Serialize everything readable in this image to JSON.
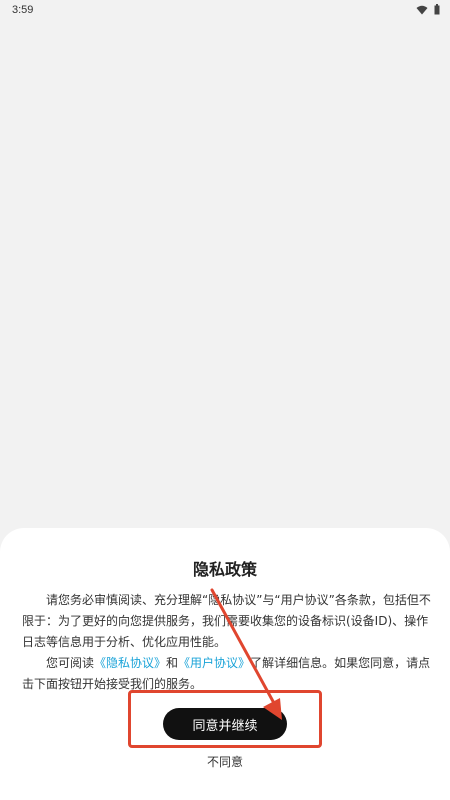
{
  "status_bar": {
    "time": "3:59",
    "icons": [
      "wifi-icon",
      "battery-icon"
    ]
  },
  "dialog": {
    "title": "隐私政策",
    "paragraph1": {
      "text": "请您务必审慎阅读、充分理解“隐私协议”与“用户协议”各条款，包括但不限于：为了更好的向您提供服务，我们需要收集您的设备标识(设备ID)、操作日志等信息用于分析、优化应用性能。"
    },
    "paragraph2": {
      "prefix": "您可阅读",
      "privacy_link": "《隐私协议》",
      "and_text": "和",
      "user_link": "《用户协议》",
      "suffix": "了解详细信息。如果您同意，请点击下面按钮开始接受我们的服务。"
    },
    "agree_label": "同意并继续",
    "disagree_label": "不同意"
  },
  "colors": {
    "link": "#1aa3d8",
    "button_bg": "#111111",
    "annotation": "#e0462f"
  }
}
